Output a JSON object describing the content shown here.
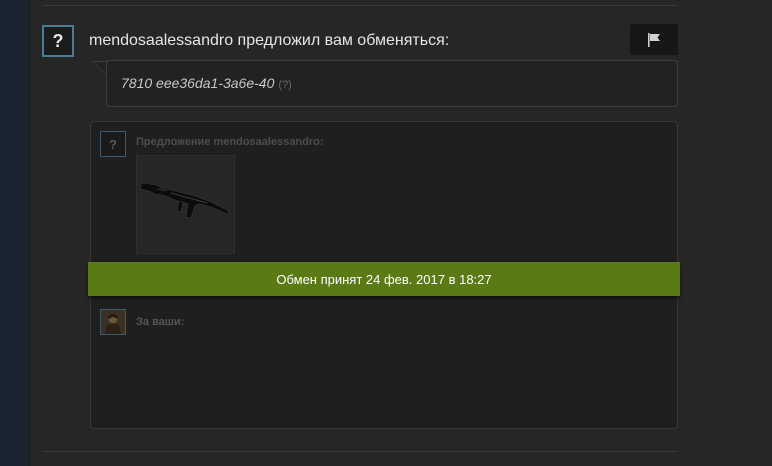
{
  "header": {
    "text": "mendosaalessandro предложил вам обменяться:",
    "avatar_glyph": "?"
  },
  "message": {
    "text": "7810 eee36da1-3a6e-40",
    "help": "(?)"
  },
  "offer": {
    "avatar_glyph": "?",
    "label": "Предложение mendosaalessandro:",
    "item_icon": "rifle-icon"
  },
  "status": {
    "banner": "Обмен принят 24 фев. 2017 в 18:27",
    "color": "#5a7a15"
  },
  "yours": {
    "label": "За ваши:"
  },
  "icons": {
    "flag": "flag-icon"
  }
}
